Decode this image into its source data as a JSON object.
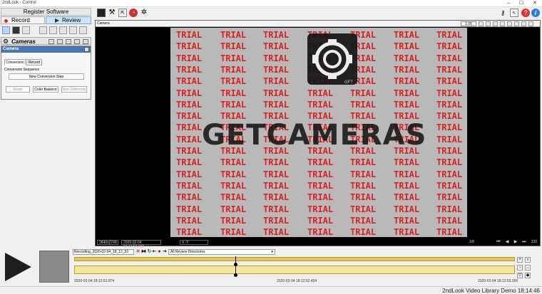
{
  "window": {
    "title": "2ndLook - Control",
    "min": "–",
    "max": "☐",
    "close": "✕"
  },
  "left": {
    "register": "Register Software",
    "record": "Record",
    "review": "Review",
    "cameras_title": "Cameras",
    "camera_panel_title": "Camera",
    "tabs": [
      "Conversion",
      "Record"
    ],
    "conversion_label": "Conversion Sequence",
    "new_step": "New Conversion Step",
    "reset": "Reset",
    "color_balance": "Color Balance",
    "non_uniformity": "Non Uniformity"
  },
  "camera_view": {
    "title": "Camera",
    "zoom": "1.05",
    "watermark": "TRIAL",
    "wordmark": "GETCAMERAS",
    "logo_sub": "GFT",
    "resolution": "3840x2748",
    "timestamp": "2020-02-04 18:12:53.269",
    "xy": "X: Y:",
    "frame": "1/8",
    "fps": "120"
  },
  "playback": {
    "recording": "Recording_2020-02-04_18_12_52",
    "directory": "All Review Directories",
    "t_start": "2020-02-04 18:12:51.874",
    "t_mid": "2020-02-04 18:12:52.424",
    "t_end": "2020-02-04 18:12:53.269"
  },
  "status": {
    "text": "2ndLook Video Library Demo 18:14:46"
  },
  "colors": {
    "accent": "#2b7fd8",
    "trial": "#d82222",
    "track": "#e2c95a"
  }
}
